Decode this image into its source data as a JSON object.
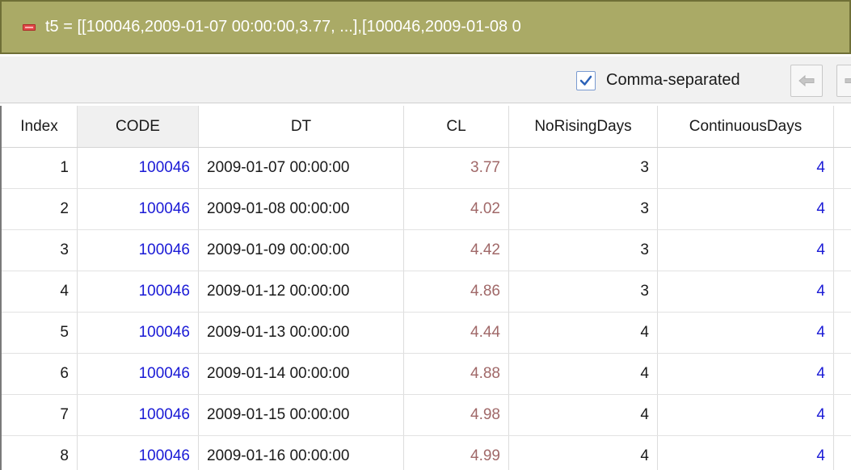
{
  "title_bar": {
    "text": "t5 = [[100046,2009-01-07 00:00:00,3.77, ...],[100046,2009-01-08 0"
  },
  "toolbar": {
    "comma_separated_label": "Comma-separated",
    "comma_separated_checked": true
  },
  "columns": [
    "Index",
    "CODE",
    "DT",
    "CL",
    "NoRisingDays",
    "ContinuousDays"
  ],
  "rows": [
    {
      "index": "1",
      "code": "100046",
      "dt": "2009-01-07 00:00:00",
      "cl": "3.77",
      "no_rising_days": "3",
      "continuous_days": "4"
    },
    {
      "index": "2",
      "code": "100046",
      "dt": "2009-01-08 00:00:00",
      "cl": "4.02",
      "no_rising_days": "3",
      "continuous_days": "4"
    },
    {
      "index": "3",
      "code": "100046",
      "dt": "2009-01-09 00:00:00",
      "cl": "4.42",
      "no_rising_days": "3",
      "continuous_days": "4"
    },
    {
      "index": "4",
      "code": "100046",
      "dt": "2009-01-12 00:00:00",
      "cl": "4.86",
      "no_rising_days": "3",
      "continuous_days": "4"
    },
    {
      "index": "5",
      "code": "100046",
      "dt": "2009-01-13 00:00:00",
      "cl": "4.44",
      "no_rising_days": "4",
      "continuous_days": "4"
    },
    {
      "index": "6",
      "code": "100046",
      "dt": "2009-01-14 00:00:00",
      "cl": "4.88",
      "no_rising_days": "4",
      "continuous_days": "4"
    },
    {
      "index": "7",
      "code": "100046",
      "dt": "2009-01-15 00:00:00",
      "cl": "4.98",
      "no_rising_days": "4",
      "continuous_days": "4"
    },
    {
      "index": "8",
      "code": "100046",
      "dt": "2009-01-16 00:00:00",
      "cl": "4.99",
      "no_rising_days": "4",
      "continuous_days": "4"
    }
  ],
  "colors": {
    "title_bar_bg": "#aaaa66",
    "numeric_blue": "#1a1ad6",
    "cl_value": "#a06868"
  },
  "icons": {
    "collapse": "collapse-icon",
    "checkbox": "checkmark-icon",
    "back": "arrow-left-icon",
    "forward": "arrow-right-icon"
  }
}
